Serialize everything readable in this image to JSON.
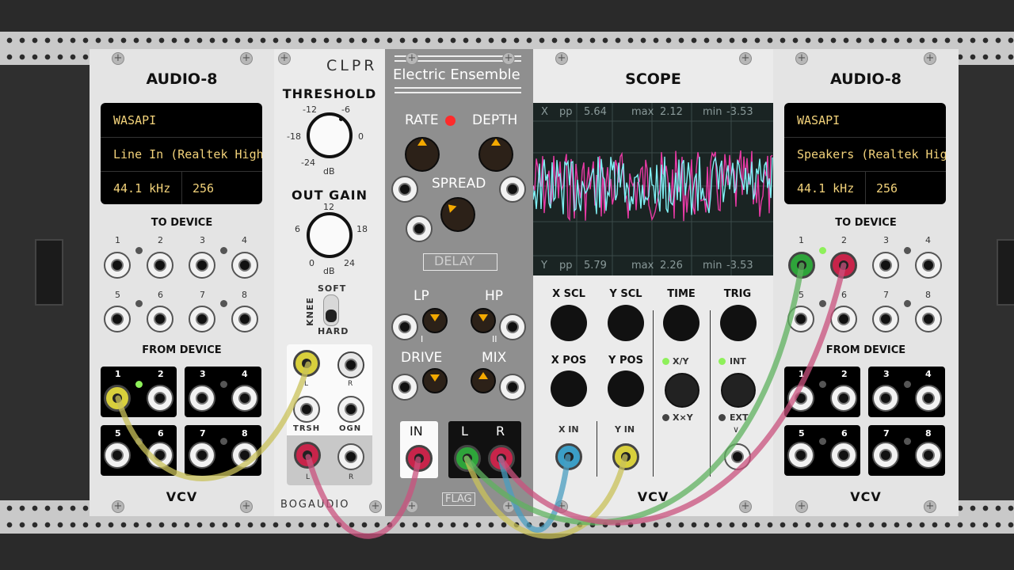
{
  "audio_left": {
    "title": "AUDIO-8",
    "driver": "WASAPI",
    "device": "Line In (Realtek High",
    "sample_rate": "44.1 kHz",
    "block_size": "256",
    "to_device_label": "TO DEVICE",
    "from_device_label": "FROM DEVICE",
    "port_numbers": [
      "1",
      "2",
      "3",
      "4",
      "5",
      "6",
      "7",
      "8"
    ],
    "logo": "VCV"
  },
  "clpr": {
    "title": "CLPR",
    "threshold_label": "THRESHOLD",
    "threshold_ticks": [
      "-12",
      "-6",
      "-18",
      "0",
      "-24",
      "dB"
    ],
    "out_gain_label": "OUT GAIN",
    "out_gain_ticks": [
      "12",
      "6",
      "18",
      "0",
      "24",
      "dB"
    ],
    "knee_label": "KNEE",
    "soft_label": "SOFT",
    "hard_label": "HARD",
    "l_label": "L",
    "r_label": "R",
    "trsh_label": "TRSH",
    "ogn_label": "OGN",
    "brand": "BOGAUDIO"
  },
  "ensemble": {
    "title": "Electric Ensemble",
    "rate_label": "RATE",
    "depth_label": "DEPTH",
    "spread_label": "SPREAD",
    "delay_label": "DELAY",
    "lp_label": "LP",
    "hp_label": "HP",
    "drive_label": "DRIVE",
    "mix_label": "MIX",
    "marker_i": "I",
    "marker_ii": "II",
    "in_label": "IN",
    "l_label": "L",
    "r_label": "R",
    "brand": "FLAG"
  },
  "scope": {
    "title": "SCOPE",
    "x_channel": "X",
    "x_pp_label": "pp",
    "x_pp": "5.64",
    "x_max_label": "max",
    "x_max": "2.12",
    "x_min_label": "min",
    "x_min": "-3.53",
    "y_channel": "Y",
    "y_pp_label": "pp",
    "y_pp": "5.79",
    "y_max_label": "max",
    "y_max": "2.26",
    "y_min_label": "min",
    "y_min": "-3.53",
    "x_scl": "X SCL",
    "y_scl": "Y SCL",
    "time": "TIME",
    "trig": "TRIG",
    "x_pos": "X POS",
    "y_pos": "Y POS",
    "xy_label": "X/Y",
    "xxy_label": "X×Y",
    "int_label": "INT",
    "ext_label": "EXT",
    "x_in": "X IN",
    "y_in": "Y IN",
    "logo": "VCV",
    "trace_colors": {
      "x": "#e83aa5",
      "y": "#7ff0f5"
    }
  },
  "audio_right": {
    "title": "AUDIO-8",
    "driver": "WASAPI",
    "device": "Speakers (Realtek Hig",
    "sample_rate": "44.1 kHz",
    "block_size": "256",
    "to_device_label": "TO DEVICE",
    "from_device_label": "FROM DEVICE",
    "port_numbers": [
      "1",
      "2",
      "3",
      "4",
      "5",
      "6",
      "7",
      "8"
    ],
    "logo": "VCV"
  },
  "cable_colors": {
    "yellow": "#c9c25a",
    "pink": "#c9517e",
    "green": "#5fb25f",
    "blue": "#4a9ec0"
  }
}
